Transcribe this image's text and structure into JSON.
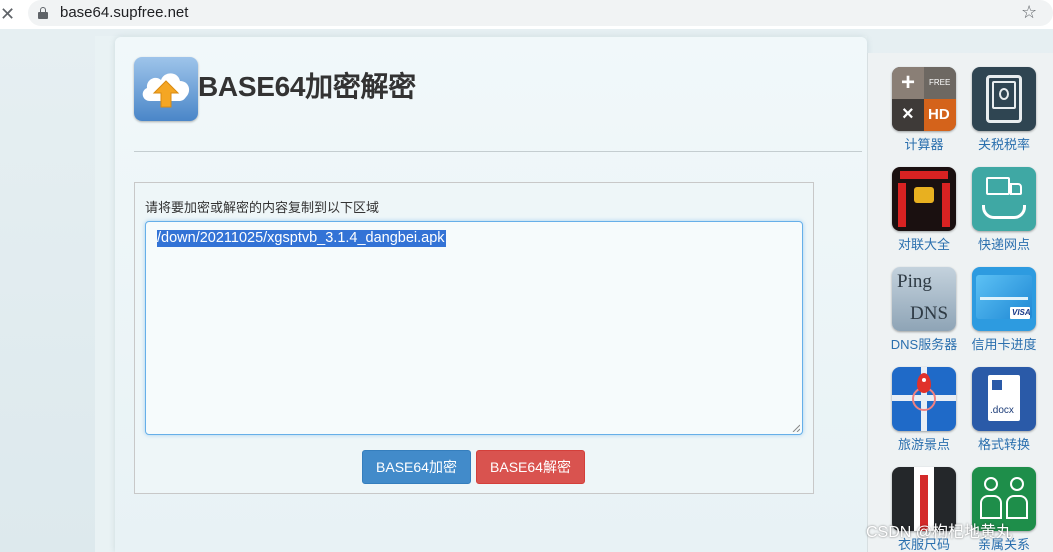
{
  "browser": {
    "url": "base64.supfree.net"
  },
  "header": {
    "title": "BASE64加密解密"
  },
  "form": {
    "label": "请将要加密或解密的内容复制到以下区域",
    "content": "/down/20211025/xgsptvb_3.1.4_dangbei.apk",
    "encode_label": "BASE64加密",
    "decode_label": "BASE64解密"
  },
  "sidebar": {
    "items": [
      {
        "label": "计算器",
        "icon": "calculator-icon",
        "badge": "FREE",
        "badge2": "HD"
      },
      {
        "label": "关税税率",
        "icon": "tariff-icon"
      },
      {
        "label": "对联大全",
        "icon": "couplet-icon"
      },
      {
        "label": "快递网点",
        "icon": "express-icon"
      },
      {
        "label": "DNS服务器",
        "icon": "dns-icon",
        "text1": "Ping",
        "text2": "DNS"
      },
      {
        "label": "信用卡进度",
        "icon": "credit-card-icon",
        "text1": "VISA"
      },
      {
        "label": "旅游景点",
        "icon": "map-pin-icon"
      },
      {
        "label": "格式转换",
        "icon": "docx-icon",
        "text1": ".docx"
      },
      {
        "label": "衣服尺码",
        "icon": "suit-icon"
      },
      {
        "label": "亲属关系",
        "icon": "family-icon"
      }
    ]
  },
  "watermark": "CSDN @枸杞地黄丸",
  "colors": {
    "accent_blue": "#428bca",
    "accent_red": "#d9534f",
    "link": "#2a6fae"
  }
}
